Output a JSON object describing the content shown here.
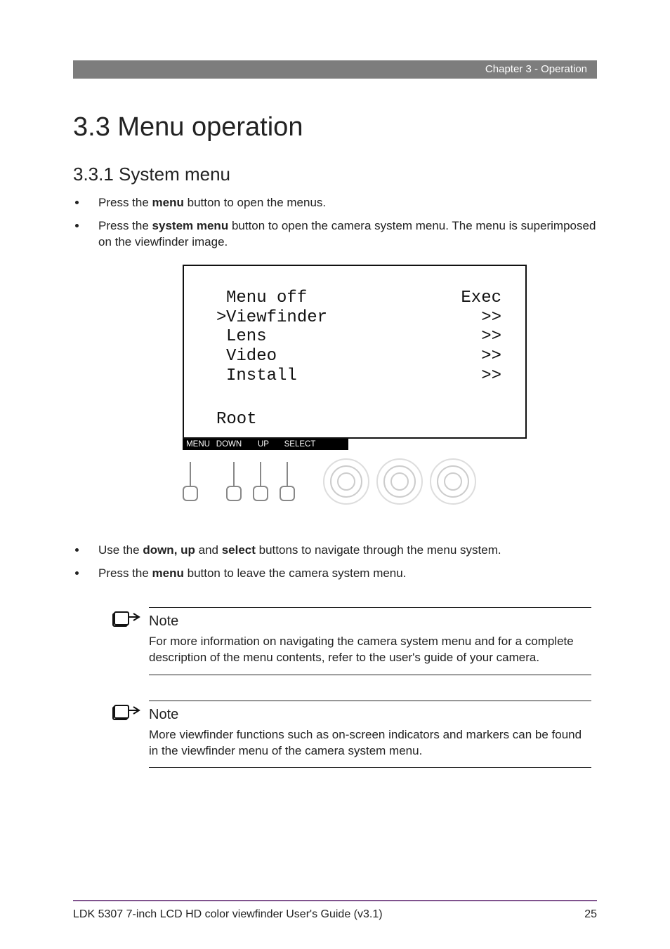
{
  "chapter_bar": "Chapter 3 - Operation",
  "section_title": "3.3  Menu operation",
  "subsection_title": "3.3.1  System menu",
  "bullets_top": [
    {
      "pre": "Press the ",
      "bold": "menu",
      "post": " button to open the menus."
    },
    {
      "pre": "Press the ",
      "bold": "system menu",
      "post": " button to open the camera system menu. The menu is superimposed on the viewfinder image."
    }
  ],
  "screen": {
    "rows": [
      {
        "prefix": "",
        "label": "Menu off",
        "value": "Exec"
      },
      {
        "prefix": ">",
        "label": "Viewfinder",
        "value": ">>"
      },
      {
        "prefix": "",
        "label": "Lens",
        "value": ">>"
      },
      {
        "prefix": "",
        "label": "Video",
        "value": ">>"
      },
      {
        "prefix": "",
        "label": "Install",
        "value": ">>"
      }
    ],
    "root": "Root"
  },
  "button_labels": {
    "menu": "MENU",
    "down": "DOWN",
    "up": "UP",
    "select": "SELECT"
  },
  "bullets_after": [
    {
      "pre": "Use the ",
      "bold": "down, up",
      "mid": " and ",
      "bold2": "select",
      "post": " buttons to navigate through the menu system."
    },
    {
      "pre": "Press the ",
      "bold": "menu",
      "post": " button to leave the camera system menu."
    }
  ],
  "notes": [
    {
      "heading": "Note",
      "body": "For more information on navigating the camera system menu and for a complete description of the menu contents, refer to the user's guide of your camera."
    },
    {
      "heading": "Note",
      "body": "More viewfinder functions such as on-screen indicators and markers can be found in the viewfinder menu of the camera system menu."
    }
  ],
  "footer": {
    "left": "LDK 5307 7-inch LCD HD color viewfinder User's Guide (v3.1)",
    "page": "25"
  }
}
